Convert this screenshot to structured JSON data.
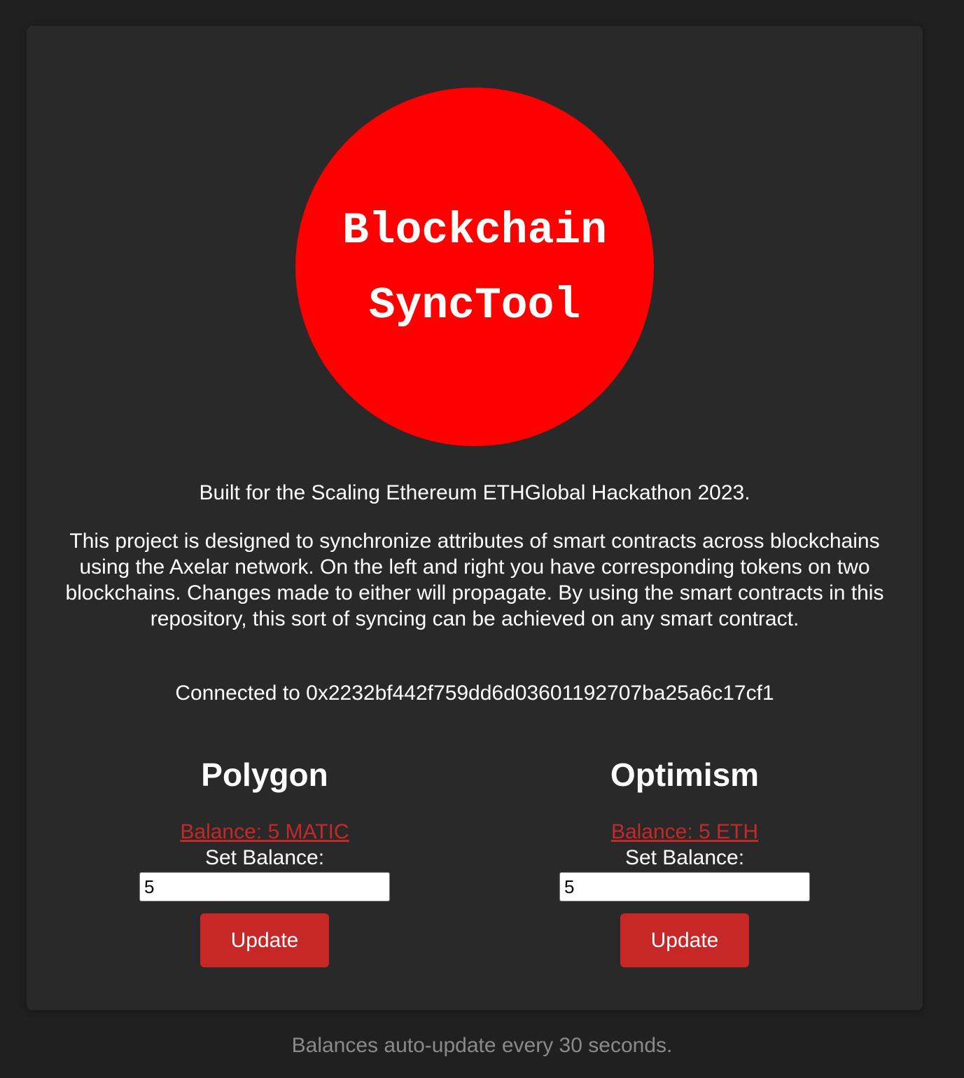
{
  "logo": {
    "line1": "Blockchain",
    "line2": "SyncTool"
  },
  "intro": {
    "built_for": "Built for the Scaling Ethereum ETHGlobal Hackathon 2023.",
    "description": "This project is designed to synchronize attributes of smart contracts across blockchains using the Axelar network. On the left and right you have corresponding tokens on two blockchains. Changes made to either will propagate. By using the smart contracts in this repository, this sort of syncing can be achieved on any smart contract.",
    "connected": "Connected to 0x2232bf442f759dd6d03601192707ba25a6c17cf1"
  },
  "chains": {
    "polygon": {
      "title": "Polygon",
      "balance": "Balance: 5 MATIC",
      "set_label": "Set Balance:",
      "input_value": "5",
      "button": "Update"
    },
    "optimism": {
      "title": "Optimism",
      "balance": "Balance: 5 ETH",
      "set_label": "Set Balance:",
      "input_value": "5",
      "button": "Update"
    }
  },
  "footer": "Balances auto-update every 30 seconds.",
  "colors": {
    "page_background": "#202020",
    "card_background": "#292929",
    "logo_red": "#ff0000",
    "accent_red": "#c62828",
    "footer_text": "#8a8a8a"
  }
}
